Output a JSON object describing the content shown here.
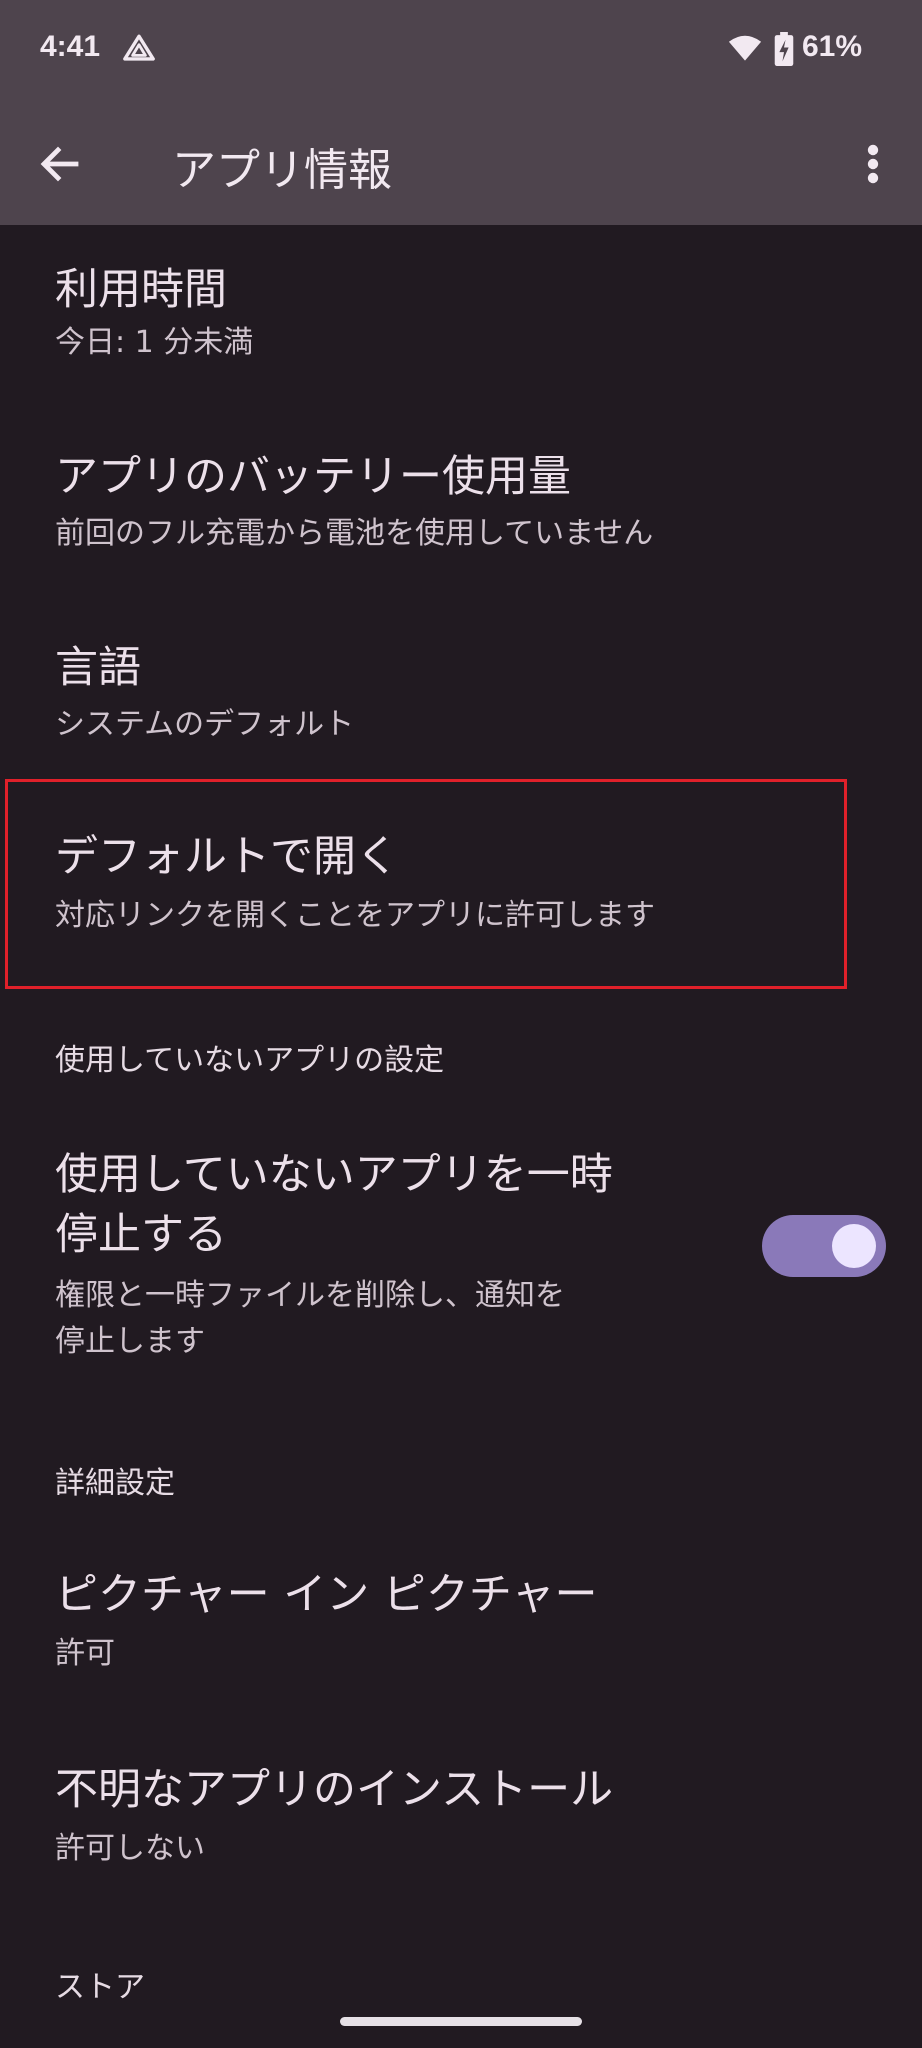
{
  "status_bar": {
    "time": "4:41",
    "battery_percent": "61%",
    "icons": [
      "drive-icon",
      "wifi-icon",
      "battery-charging-icon"
    ]
  },
  "app_bar": {
    "title": "アプリ情報",
    "back_icon": "arrow-back-icon",
    "more_icon": "more-vert-icon"
  },
  "items": [
    {
      "title": "利用時間",
      "subtitle": "今日: 1 分未満"
    },
    {
      "title": "アプリのバッテリー使用量",
      "subtitle": "前回のフル充電から電池を使用していません"
    },
    {
      "title": "言語",
      "subtitle": "システムのデフォルト"
    },
    {
      "title": "デフォルトで開く",
      "subtitle": "対応リンクを開くことをアプリに許可します"
    }
  ],
  "unused_apps": {
    "header": "使用していないアプリの設定",
    "title_line1": "使用していないアプリを一時",
    "title_line2": "停止する",
    "subtitle_line1": "権限と一時ファイルを削除し、通知を",
    "subtitle_line2": "停止します",
    "toggle_on": true
  },
  "advanced": {
    "header": "詳細設定",
    "items": [
      {
        "title": "ピクチャー イン ピクチャー",
        "subtitle": "許可"
      },
      {
        "title": "不明なアプリのインストール",
        "subtitle": "許可しない"
      }
    ]
  },
  "store": {
    "header": "ストア"
  },
  "colors": {
    "background": "#211a21",
    "app_bar": "#4e444d",
    "toggle_track": "#8a79b9",
    "highlight_border": "#e0202a"
  }
}
